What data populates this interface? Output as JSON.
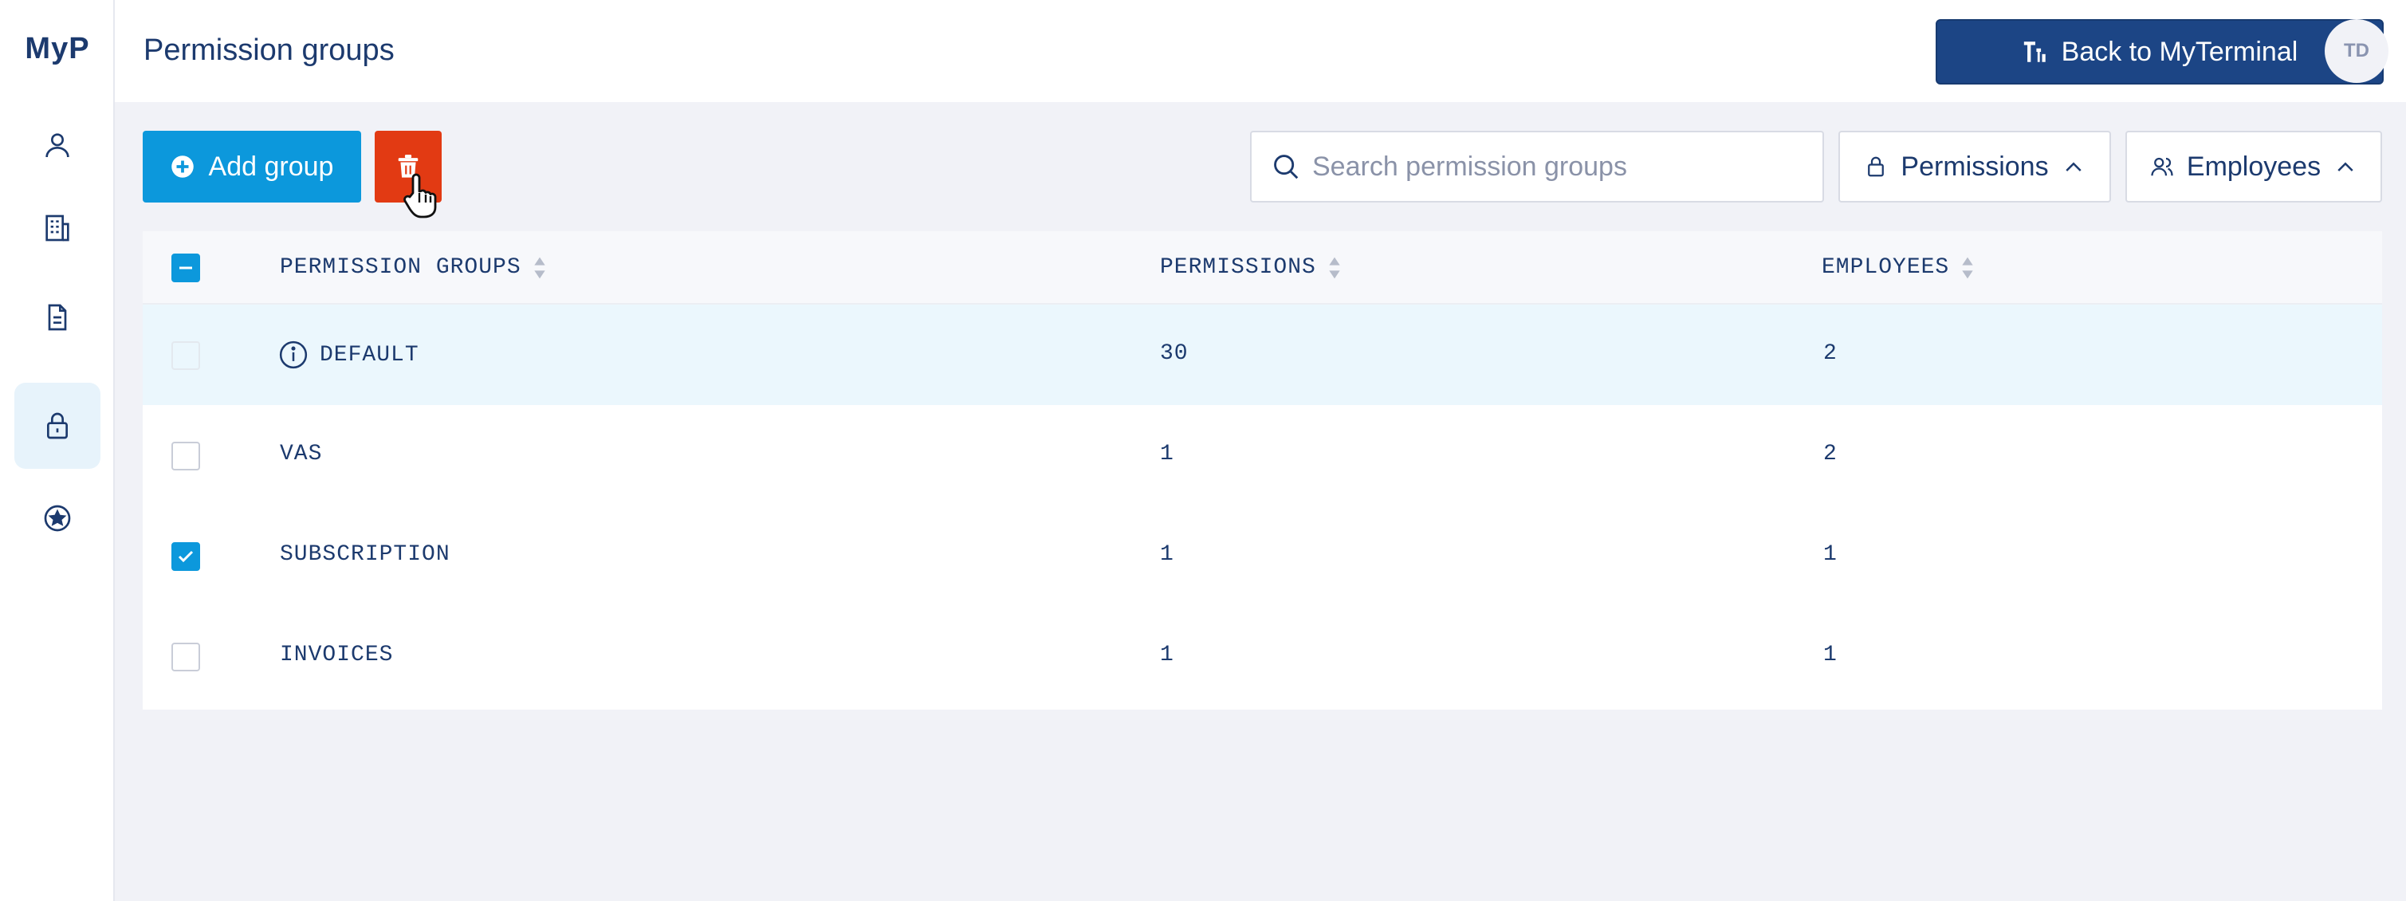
{
  "app": {
    "logo": "MyP"
  },
  "header": {
    "title": "Permission groups",
    "back_label": "Back to MyTerminal",
    "avatar_initials": "TD"
  },
  "toolbar": {
    "add_label": "Add group",
    "search_placeholder": "Search permission groups",
    "filter_permissions": "Permissions",
    "filter_employees": "Employees"
  },
  "table": {
    "columns": [
      "PERMISSION GROUPS",
      "PERMISSIONS",
      "EMPLOYEES"
    ],
    "rows": [
      {
        "name": "DEFAULT",
        "permissions": "30",
        "employees": "2"
      },
      {
        "name": "VAS",
        "permissions": "1",
        "employees": "2"
      },
      {
        "name": "SUBSCRIPTION",
        "permissions": "1",
        "employees": "1"
      },
      {
        "name": "INVOICES",
        "permissions": "1",
        "employees": "1"
      }
    ]
  },
  "colors": {
    "primary": "#0c98dc",
    "danger": "#e23a13",
    "navy": "#1c4585",
    "text": "#1c3a6e"
  },
  "icons": [
    "user-icon",
    "building-icon",
    "document-icon",
    "lock-icon",
    "star-icon",
    "plus-circle-icon",
    "trash-icon",
    "search-icon",
    "info-icon",
    "sort-icon",
    "chevron-up-icon",
    "users-icon",
    "terminal-icon"
  ]
}
